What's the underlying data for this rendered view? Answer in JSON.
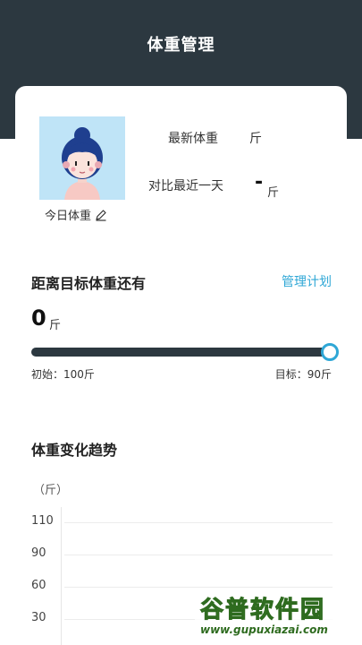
{
  "header": {
    "title": "体重管理"
  },
  "profile": {
    "today_weight_label": "今日体重",
    "latest_weight_label": "最新体重",
    "latest_weight_unit": "斤",
    "compare_label": "对比最近一天",
    "compare_value": "-",
    "compare_unit": "斤"
  },
  "goal": {
    "title": "距离目标体重还有",
    "manage_plan": "管理计划",
    "remaining_value": "0",
    "remaining_unit": "斤",
    "progress_fraction": 1.0,
    "start_text": "初始：100斤",
    "target_text": "目标：90斤"
  },
  "trend": {
    "title": "体重变化趋势",
    "unit_label": "（斤）",
    "y_ticks": [
      "110",
      "90",
      "60",
      "30"
    ]
  },
  "watermark": {
    "top": "谷普软件园",
    "bottom": "www.gupuxiazai.com"
  },
  "colors": {
    "header_bg": "#2c3840",
    "accent": "#2fa7d6",
    "progress_fill": "#2c3840",
    "avatar_bg": "#bfe4f7"
  }
}
